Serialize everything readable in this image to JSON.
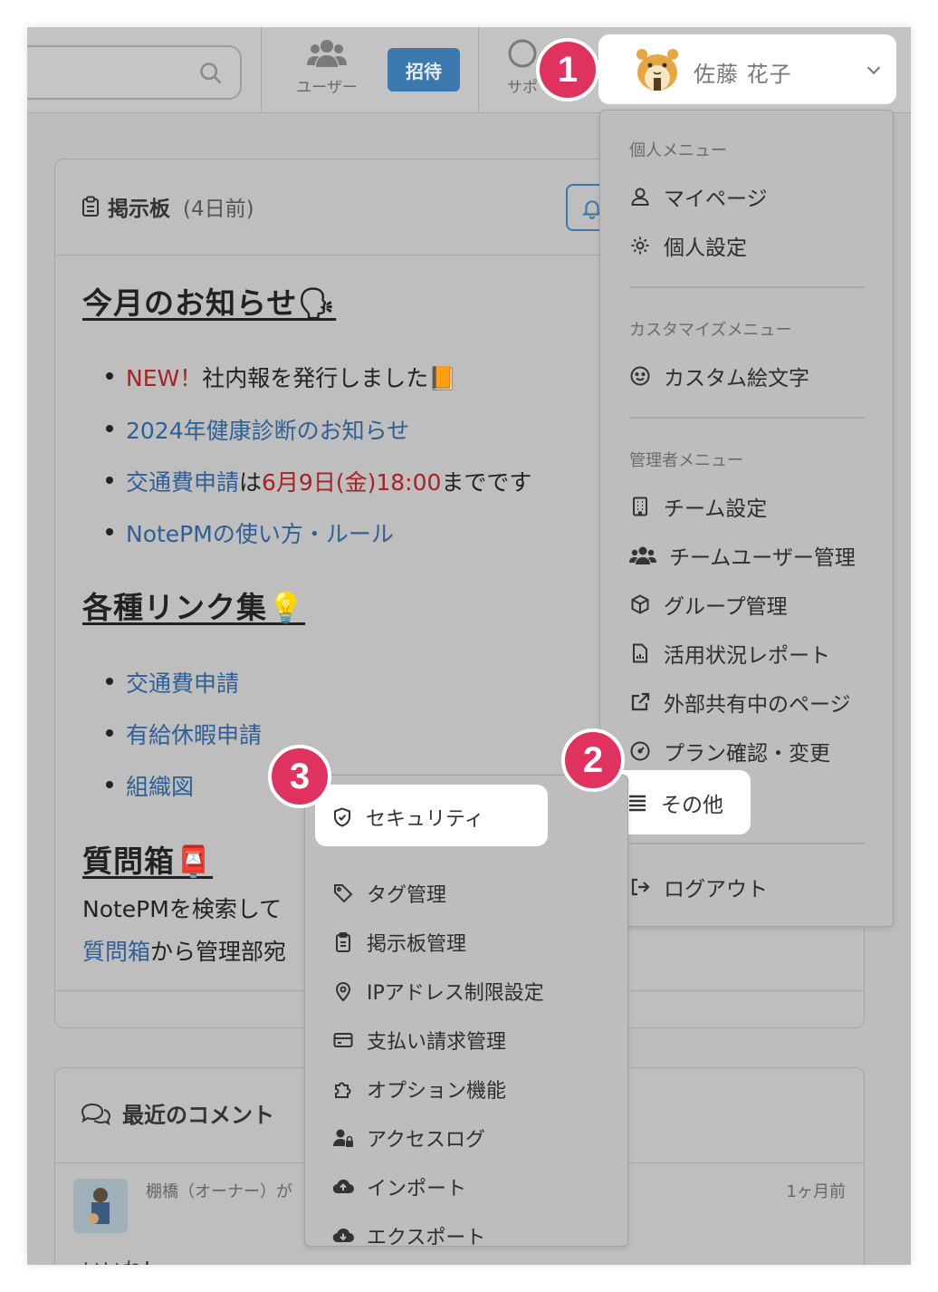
{
  "header": {
    "nav_users_label": "ユーザー",
    "invite_label": "招待",
    "nav_support_label": "サポ",
    "user_name": "佐藤 花子"
  },
  "board": {
    "title": "掲示板",
    "ago": "(4日前)",
    "section1_title": "今月のお知らせ🗣",
    "item1_new": "NEW！",
    "item1_text": "社内報を発行しました📙",
    "item2_link": "2024年健康診断のお知らせ",
    "item3_link": "交通費申請",
    "item3_mid": "は",
    "item3_date": "6月9日(金)18:00",
    "item3_tail": "までです",
    "item4_link": "NotePMの使い方・ルール",
    "section2_title": "各種リンク集💡",
    "link1": "交通費申請",
    "link2": "有給休暇申請",
    "link3": "組織図",
    "section3_title": "質問箱📮",
    "q_line1": "NotePMを検索して",
    "q_link": "質問箱",
    "q_line2": "から管理部宛"
  },
  "comments": {
    "title": "最近のコメント",
    "author": "棚橋（オーナー）が",
    "time": "1ヶ月前",
    "body": "いいね！"
  },
  "user_menu": {
    "personal_section": "個人メニュー",
    "my_page": "マイページ",
    "personal_settings": "個人設定",
    "custom_section": "カスタマイズメニュー",
    "custom_emoji": "カスタム絵文字",
    "admin_section": "管理者メニュー",
    "team_settings": "チーム設定",
    "team_users": "チームユーザー管理",
    "group_mgmt": "グループ管理",
    "usage_report": "活用状況レポート",
    "external_pages": "外部共有中のページ",
    "plan": "プラン確認・変更",
    "other": "その他",
    "logout": "ログアウト"
  },
  "sub_menu": {
    "security": "セキュリティ",
    "tags": "タグ管理",
    "board_mgmt": "掲示板管理",
    "ip_restrict": "IPアドレス制限設定",
    "billing": "支払い請求管理",
    "options": "オプション機能",
    "access_log": "アクセスログ",
    "import": "インポート",
    "export": "エクスポート"
  },
  "badges": {
    "one": "1",
    "two": "2",
    "three": "3"
  },
  "colors": {
    "badge": "#e0325f",
    "accent": "#3b78ad",
    "link": "#2f5f95",
    "alert": "#a72222"
  }
}
